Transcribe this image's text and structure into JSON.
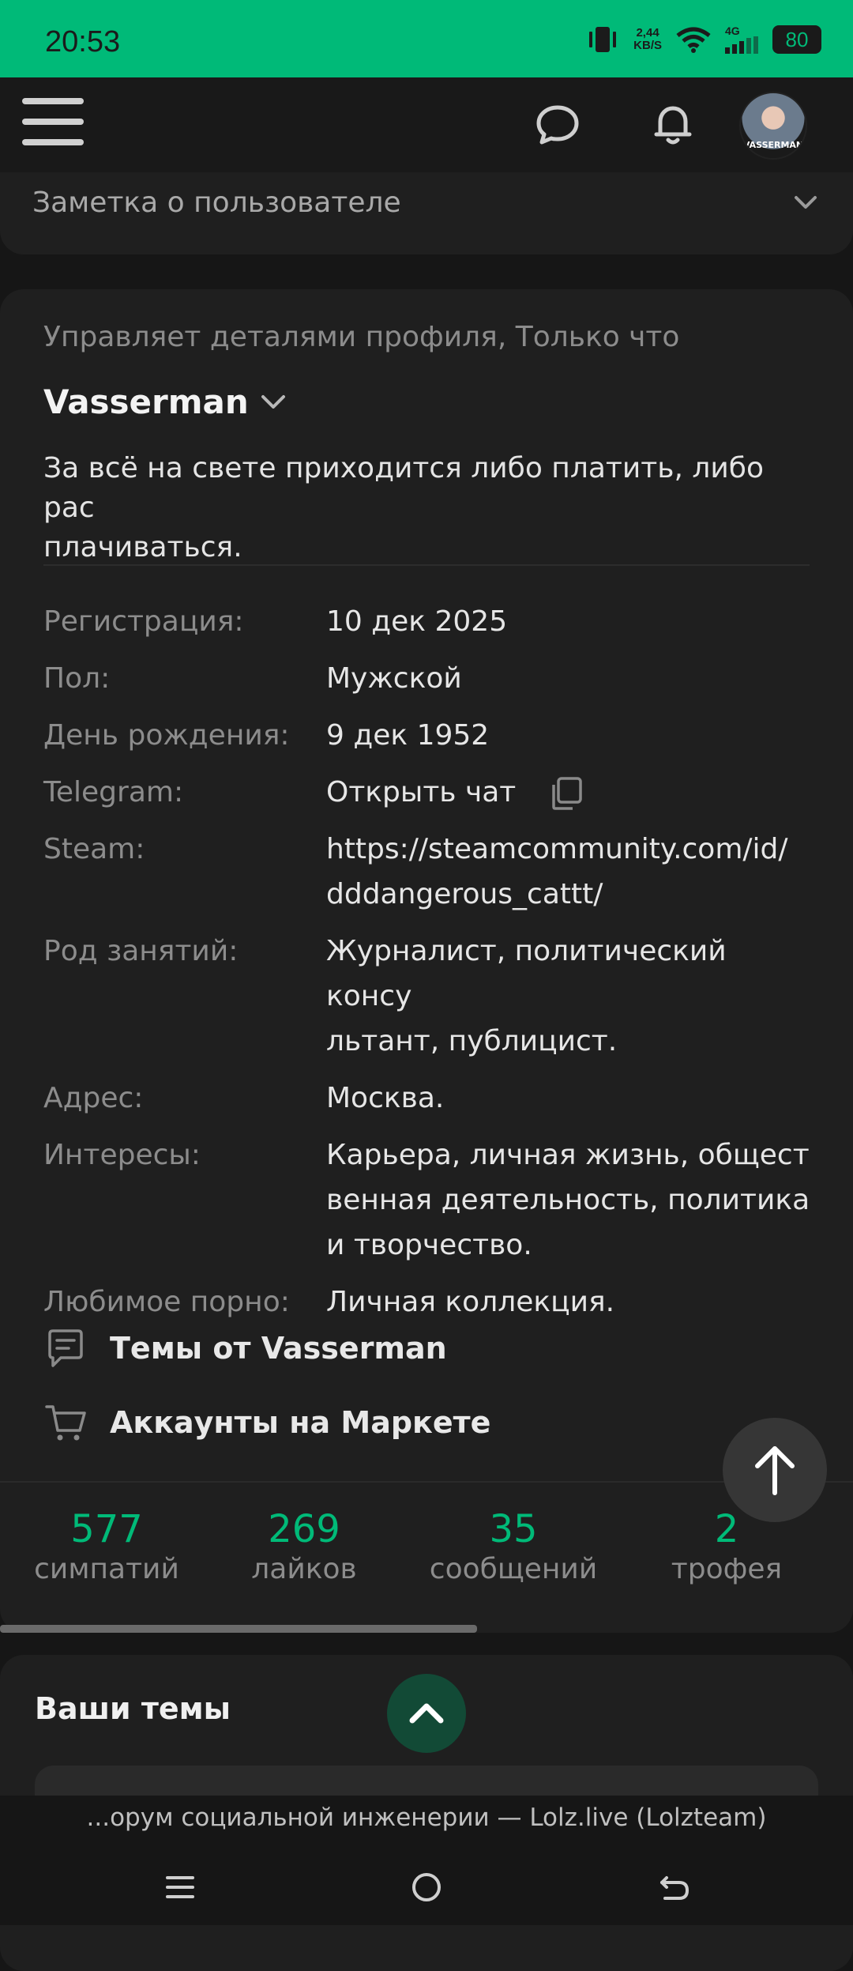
{
  "status_bar": {
    "time": "20:53",
    "net_speed_value": "2,44",
    "net_speed_unit": "KB/S",
    "signal": "4G",
    "battery": "80"
  },
  "header": {
    "avatar_label": "VASSERMAN"
  },
  "note": {
    "title": "Заметка о пользователе"
  },
  "profile": {
    "activity": "Управляет деталями профиля, Только что",
    "username": "Vasserman",
    "status_line1": "За всё на свете приходится либо платить, либо рас",
    "status_line2": "плачиваться.",
    "fields": [
      {
        "label": "Регистрация:",
        "value": "10 дек 2025"
      },
      {
        "label": "Пол:",
        "value": "Мужской"
      },
      {
        "label": "День рождения:",
        "value": "9 дек 1952"
      },
      {
        "label": "Telegram:",
        "value": "Открыть чат"
      },
      {
        "label": "Steam:",
        "value1": "https://steamcommunity.com/id/",
        "value2": "dddangerous_cattt/"
      },
      {
        "label": "Род занятий:",
        "value1": "Журналист, политический консу",
        "value2": "льтант, публицист."
      },
      {
        "label": "Адрес:",
        "value": "Москва."
      },
      {
        "label": "Интересы:",
        "value1": "Карьера, личная жизнь, общест",
        "value2": "венная деятельность, политика",
        "value3": "и творчество."
      },
      {
        "label": "Любимое порно:",
        "value": "Личная коллекция."
      }
    ],
    "links": {
      "threads": "Темы от Vasserman",
      "market": "Аккаунты на Маркете"
    },
    "stats": [
      {
        "number": "577",
        "label": "симпатий"
      },
      {
        "number": "269",
        "label": "лайков"
      },
      {
        "number": "35",
        "label": "сообщений"
      },
      {
        "number": "2",
        "label": "трофея"
      }
    ]
  },
  "themes": {
    "title": "Ваши темы"
  },
  "browser": {
    "url_title": "...орум социальной инженерии — Lolz.live (Lolzteam)"
  },
  "colors": {
    "accent": "#00ba78",
    "background": "#161616",
    "card": "#1f1f1f"
  }
}
